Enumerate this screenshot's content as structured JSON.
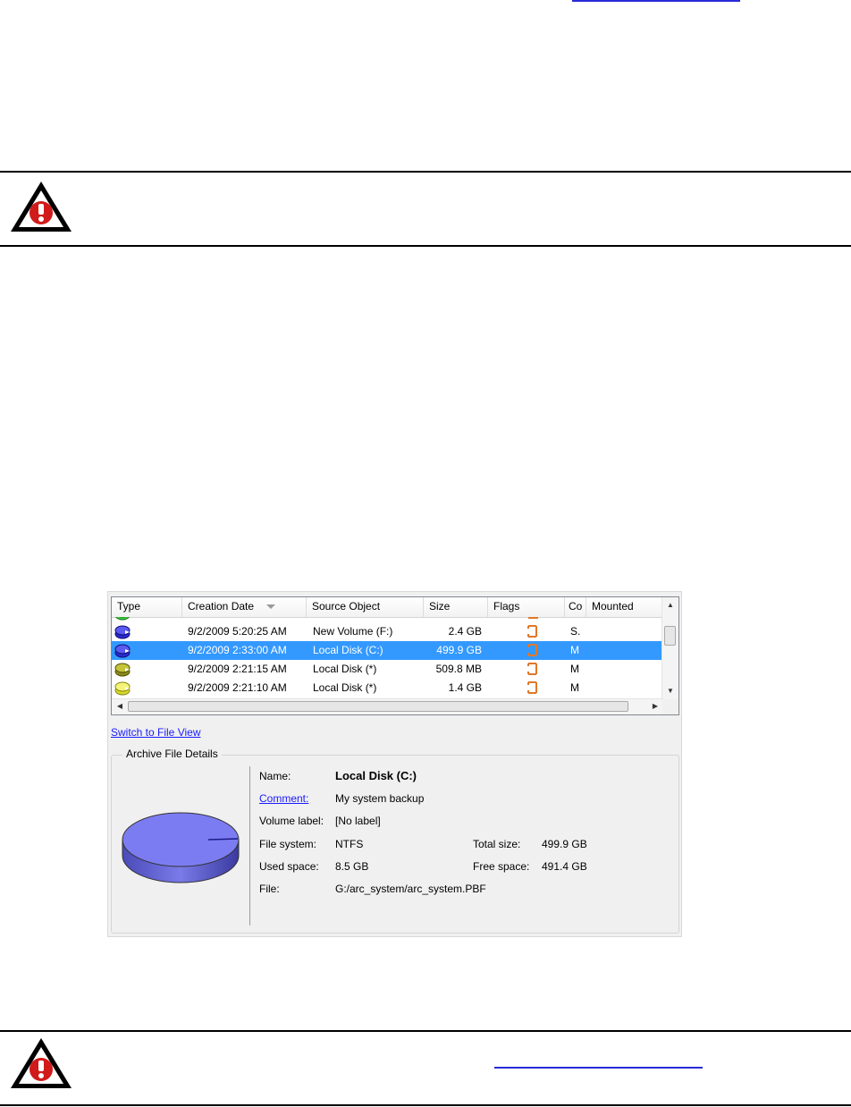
{
  "list": {
    "columns": [
      "Type",
      "Creation Date",
      "Source Object",
      "Size",
      "Flags",
      "Co",
      "Mounted"
    ],
    "rows": [
      {
        "date": "9/2/2009 5:20:25 AM",
        "source": "New Volume (F:)",
        "size": "2.4 GB",
        "co": "S.",
        "selected": false,
        "icon_color": "#2a2ad0"
      },
      {
        "date": "9/2/2009 2:33:00 AM",
        "source": "Local Disk (C:)",
        "size": "499.9 GB",
        "co": "M",
        "selected": true,
        "icon_color": "#2a2ad0"
      },
      {
        "date": "9/2/2009 2:21:15 AM",
        "source": "Local Disk (*)",
        "size": "509.8 MB",
        "co": "M",
        "selected": false,
        "icon_color": "#a0a020"
      },
      {
        "date": "9/2/2009 2:21:10 AM",
        "source": "Local Disk (*)",
        "size": "1.4 GB",
        "co": "M",
        "selected": false,
        "icon_color": "#d8d830"
      }
    ]
  },
  "switch_link": "Switch to File View",
  "details": {
    "group_title": "Archive File Details",
    "name_label": "Name:",
    "name_value": "Local Disk (C:)",
    "comment_label": "Comment:",
    "comment_value": "My system backup",
    "volume_label": "Volume label:",
    "volume_value": "[No label]",
    "fs_label": "File system:",
    "fs_value": "NTFS",
    "used_label": "Used space:",
    "used_value": "8.5 GB",
    "file_label": "File:",
    "file_value": "G:/arc_system/arc_system.PBF",
    "total_label": "Total size:",
    "total_value": "499.9 GB",
    "free_label": "Free space:",
    "free_value": "491.4 GB"
  },
  "colors": {
    "selection": "#3399ff",
    "link": "#1a1aff",
    "warning_red": "#d11a1a"
  }
}
